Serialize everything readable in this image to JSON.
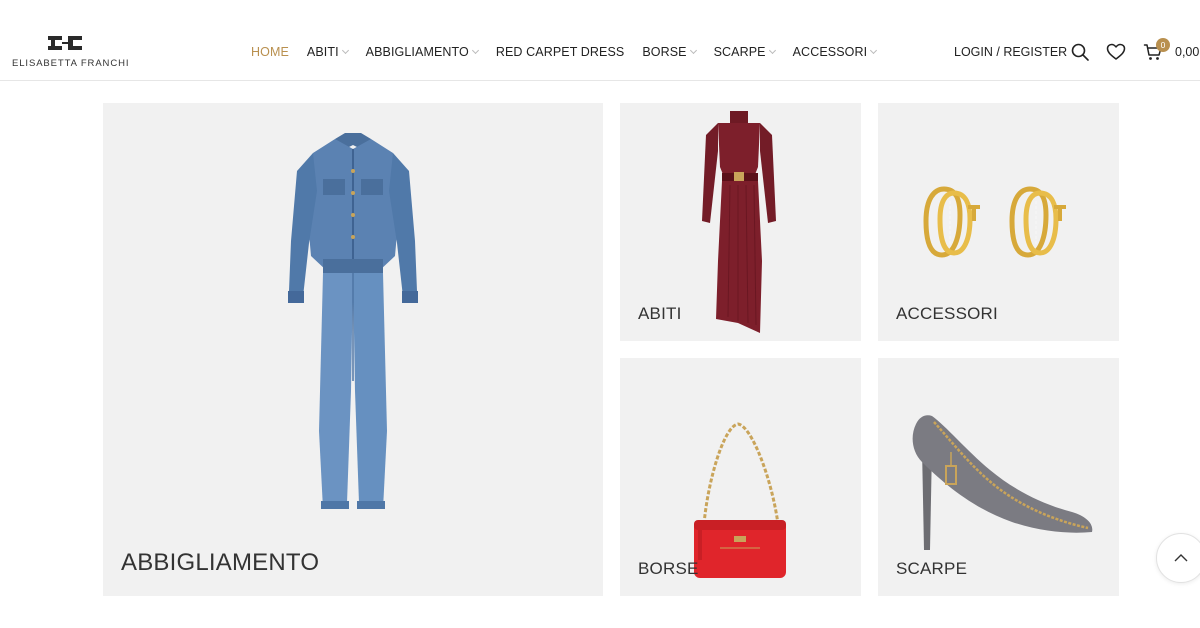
{
  "brand": {
    "name": "ELISABETTA FRANCHI",
    "logo_mark_icon": "ef-monogram-icon"
  },
  "nav": {
    "items": [
      {
        "label": "HOME",
        "active": true,
        "has_dropdown": false
      },
      {
        "label": "ABITI",
        "active": false,
        "has_dropdown": true
      },
      {
        "label": "ABBIGLIAMENTO",
        "active": false,
        "has_dropdown": true
      },
      {
        "label": "RED CARPET DRESS",
        "active": false,
        "has_dropdown": false
      },
      {
        "label": "BORSE",
        "active": false,
        "has_dropdown": true
      },
      {
        "label": "SCARPE",
        "active": false,
        "has_dropdown": true
      },
      {
        "label": "ACCESSORI",
        "active": false,
        "has_dropdown": true
      }
    ]
  },
  "account": {
    "login_label": "LOGIN / REGISTER"
  },
  "icons": {
    "search": "search-icon",
    "wishlist": "heart-icon",
    "cart": "cart-icon",
    "scroll_top": "chevron-up-icon"
  },
  "cart": {
    "count": "0",
    "total": "0,00"
  },
  "categories": [
    {
      "label": "ABBIGLIAMENTO",
      "image": "denim-jumpsuit"
    },
    {
      "label": "ABITI",
      "image": "burgundy-knit-dress"
    },
    {
      "label": "ACCESSORI",
      "image": "gold-earrings"
    },
    {
      "label": "BORSE",
      "image": "red-shoulder-bag"
    },
    {
      "label": "SCARPE",
      "image": "grey-suede-pump"
    }
  ],
  "colors": {
    "accent": "#b9904f",
    "tile_bg": "#f1f1f1",
    "text": "#222222"
  }
}
